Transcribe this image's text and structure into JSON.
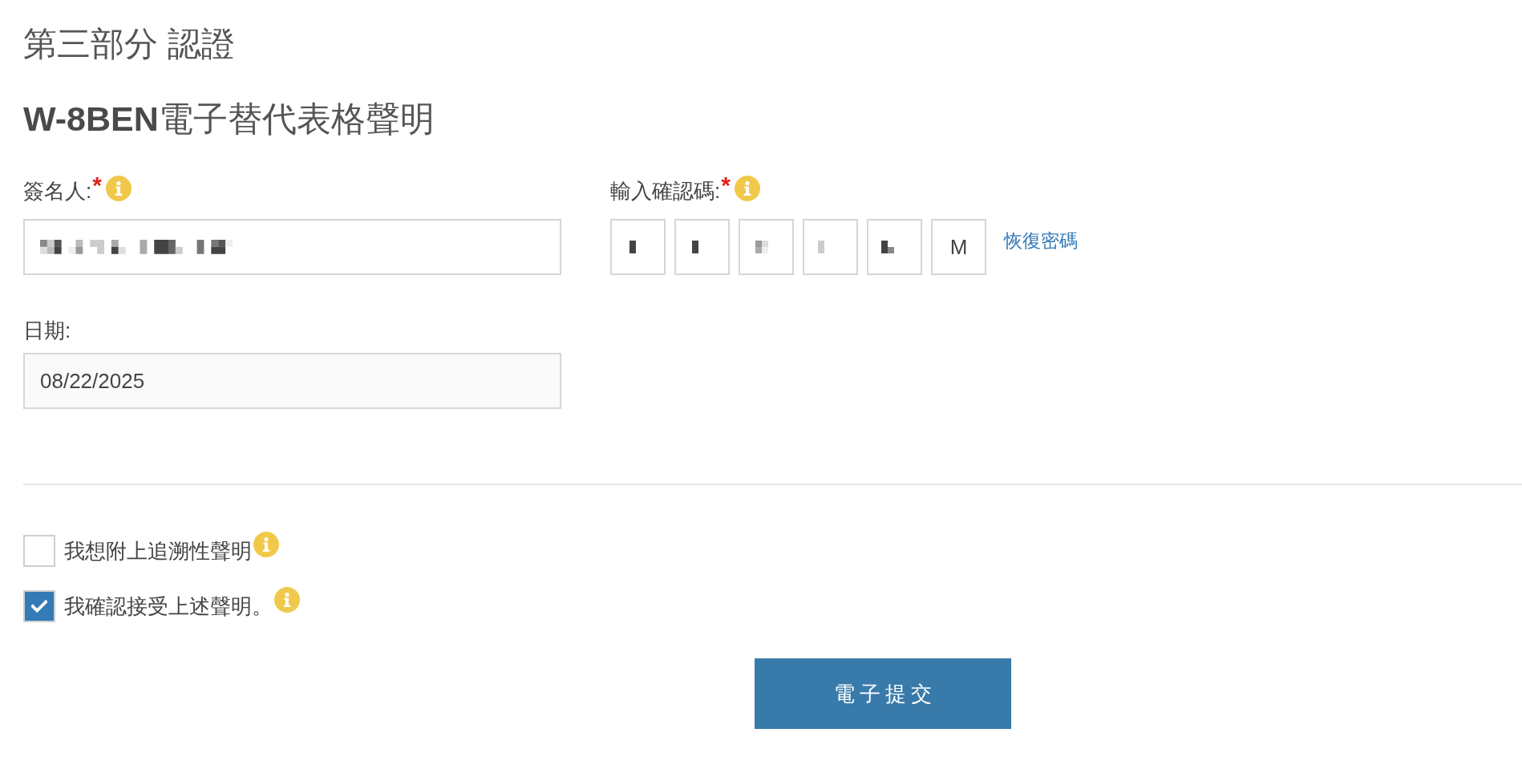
{
  "heading": "第三部分 認證",
  "subheading": "**W-8BEN**電子替代表格聲明",
  "signer": {
    "label": "簽名人:",
    "required_mark": "*",
    "info": true,
    "pixelated": true
  },
  "code": {
    "label": "輸入確認碼:",
    "required_mark": "*",
    "info": true,
    "boxes": [
      {
        "kind": "pixelated"
      },
      {
        "kind": "pixelated"
      },
      {
        "kind": "pixelated"
      },
      {
        "kind": "pixelated"
      },
      {
        "kind": "pixelated"
      },
      {
        "kind": "text",
        "value": "M"
      }
    ],
    "link": "恢復密碼"
  },
  "date": {
    "label": "日期:",
    "value": "08/22/2025"
  },
  "checkboxes": [
    {
      "label": "我想附上追溯性聲明",
      "checked": false,
      "info": true
    },
    {
      "label": "我確認接受上述聲明。",
      "checked": true,
      "info": true
    }
  ],
  "submit_button": {
    "label": "電子提交"
  }
}
